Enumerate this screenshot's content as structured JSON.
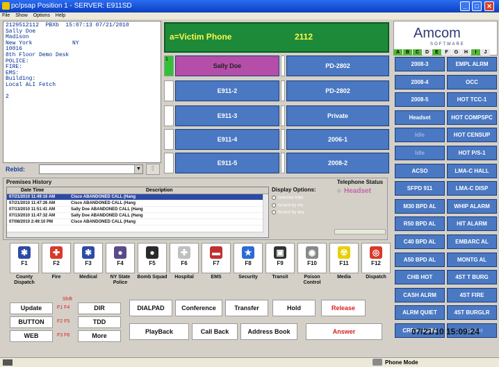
{
  "window": {
    "title": "pc/psap  Position 1 - SERVER: E911SD",
    "menu": [
      "File",
      "Show",
      "Options",
      "Help"
    ]
  },
  "ali": {
    "text": "2129512112  PBXb  15:07:13 07/21/2010\nSally Doe\nMadison\nNew York            NY\n10016\n8th Floor Demo Desk\nPOLICE:\nFIRE:\nEMS:\nBuilding:\nLocal ALI Fetch\n\n2"
  },
  "rebid": {
    "label": "Rebid:"
  },
  "call": {
    "label": "a=Victim Phone",
    "number": "2112"
  },
  "lines": [
    {
      "indicator": "1",
      "left": "Sally Doe",
      "right": "PD-2802"
    },
    {
      "indicator": "",
      "left": "E911-2",
      "right": "PD-2802"
    },
    {
      "indicator": "",
      "left": "E911-3",
      "right": "Private"
    },
    {
      "indicator": "",
      "left": "E911-4",
      "right": "2006-1"
    },
    {
      "indicator": "",
      "left": "E911-5",
      "right": "2008-2"
    }
  ],
  "logo": {
    "name": "Amcom",
    "tagline": "SOFTWARE"
  },
  "alphabet": [
    "A",
    "B",
    "C",
    "D",
    "E",
    "F",
    "G",
    "H",
    "I",
    "J"
  ],
  "speed_dials": {
    "left": [
      "2008-3",
      "2008-4",
      "2008-5",
      "Headset",
      "Idle",
      "Idle",
      "ACSO",
      "SFPD 911",
      "M30 BPD AL",
      "R50 BPD AL",
      "C40 BPD AL",
      "A50 BPD AL",
      "CHB HOT",
      "CASH ALRM",
      "ALRM QUIET",
      "CREW ALRM"
    ],
    "right": [
      "EMPL ALRM",
      "OCC",
      "HOT TCC-1",
      "HOT COMPSPC",
      "HOT CENSUP",
      "HOT P/S-1",
      "LMA-C HALL",
      "LMA-C DISP",
      "WHIP ALARM",
      "HIT ALARM",
      "EMBARC AL",
      "MONTG AL",
      "4ST T BURG",
      "4ST FIRE",
      "4ST BURGLR",
      "Headset"
    ]
  },
  "datetime": "07/21/10  15:09:24",
  "premises": {
    "title": "Premises History",
    "headers": [
      "Date Time",
      "Description"
    ],
    "rows": [
      {
        "date": "07/21/2010 11:49:16 AM",
        "desc": "Cisco ABANDONED CALL (Hang"
      },
      {
        "date": "07/21/2010 11:47:26 AM",
        "desc": "Cisco ABANDONED CALL (Hang"
      },
      {
        "date": "07/13/2010 11:51:41 AM",
        "desc": "Sally Doe ABANDONED CALL (Hang"
      },
      {
        "date": "07/13/2010 11:47:32 AM",
        "desc": "Sally Doe ABANDONED CALL (Hang"
      },
      {
        "date": "07/08/2010 2:49:10 PM",
        "desc": "Cisco ABANDONED CALL (Hang"
      }
    ],
    "display_options": {
      "title": "Display Options:",
      "options": [
        "Selected Addr.",
        "Answ'd by me",
        "Answ'd by any"
      ]
    },
    "telephone": {
      "title": "Telephone Status",
      "value": "Headset"
    }
  },
  "emergency": [
    {
      "key": "F1",
      "label": "County Dispatch",
      "color": "#2d4aa6",
      "glyph": "✱"
    },
    {
      "key": "F2",
      "label": "Fire",
      "color": "#d83a2a",
      "glyph": "✚"
    },
    {
      "key": "F3",
      "label": "Medical",
      "color": "#2d4aa6",
      "glyph": "✱"
    },
    {
      "key": "F4",
      "label": "NY State Police",
      "color": "#5a4a8a",
      "glyph": "●"
    },
    {
      "key": "F5",
      "label": "Bomb Squad",
      "color": "#2a2a2a",
      "glyph": "●"
    },
    {
      "key": "F6",
      "label": "Hospital",
      "color": "#c0c0c0",
      "glyph": "✚"
    },
    {
      "key": "F7",
      "label": "EMS",
      "color": "#c03030",
      "glyph": "▬"
    },
    {
      "key": "F8",
      "label": "Security",
      "color": "#2d6ad8",
      "glyph": "★"
    },
    {
      "key": "F9",
      "label": "Transit",
      "color": "#333333",
      "glyph": "▣"
    },
    {
      "key": "F10",
      "label": "Poison Control",
      "color": "#888888",
      "glyph": "◉"
    },
    {
      "key": "F11",
      "label": "Media",
      "color": "#e8d000",
      "glyph": "☢"
    },
    {
      "key": "F12",
      "label": "Dispatch",
      "color": "#d83a2a",
      "glyph": "◎"
    }
  ],
  "sidebox": {
    "shift": "Shift",
    "buttons": [
      {
        "label": "Update",
        "keys": "F1  F4",
        "label2": "DIR"
      },
      {
        "label": "BUTTON",
        "keys": "F2  F5",
        "label2": "TDD"
      },
      {
        "label": "WEB",
        "keys": "F3  F6",
        "label2": "More"
      }
    ]
  },
  "funcs": {
    "row1": [
      "DIALPAD",
      "Conference",
      "Transfer",
      "Hold",
      "Release"
    ],
    "row2": [
      "PlayBack",
      "Call Back",
      "Address Book",
      "Answer"
    ]
  },
  "status": {
    "mode": "Phone Mode"
  }
}
